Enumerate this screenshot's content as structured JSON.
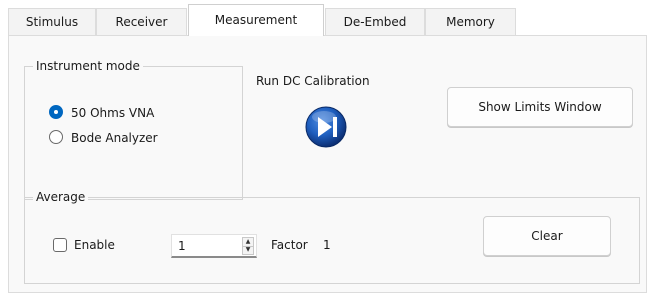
{
  "tabs": [
    {
      "label": "Stimulus",
      "active": false
    },
    {
      "label": "Receiver",
      "active": false
    },
    {
      "label": "Measurement",
      "active": true
    },
    {
      "label": "De-Embed",
      "active": false
    },
    {
      "label": "Memory",
      "active": false
    }
  ],
  "instrument_mode": {
    "title": "Instrument mode",
    "options": [
      {
        "label": "50 Ohms VNA",
        "selected": true
      },
      {
        "label": "Bode Analyzer",
        "selected": false
      }
    ]
  },
  "dc_calibration": {
    "label": "Run DC Calibration",
    "icon": "play-pause-icon",
    "icon_colors": [
      "#1f5fbf",
      "#0c2f74"
    ]
  },
  "show_limits_button": "Show Limits Window",
  "average": {
    "title": "Average",
    "enable_label": "Enable",
    "enable_checked": false,
    "factor_input_value": "1",
    "factor_label": "Factor",
    "factor_value": "1",
    "clear_label": "Clear"
  },
  "colors": {
    "accent": "#0067c0"
  }
}
